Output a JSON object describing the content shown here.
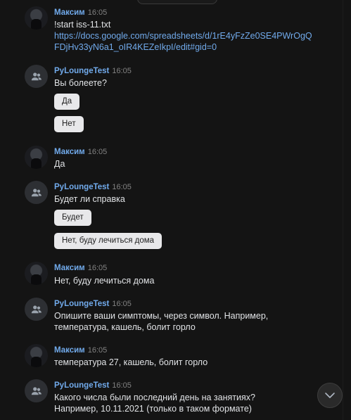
{
  "messages": [
    {
      "author": "Максим",
      "time": "16:05",
      "text": "!start iss-11.txt",
      "link_line1": "https://docs.google.com/spreadsheets/d/1rE4yFzZe0SE4PWrOgQ",
      "link_line2": "FDjHv33yN6a1_oIR4KEZeIkpI/edit#gid=0"
    },
    {
      "author": "PyLoungeTest",
      "time": "16:05",
      "text": "Вы болеете?",
      "buttons": [
        "Да",
        "Нет"
      ]
    },
    {
      "author": "Максим",
      "time": "16:05",
      "text": "Да"
    },
    {
      "author": "PyLoungeTest",
      "time": "16:05",
      "text": "Будет ли справка",
      "buttons": [
        "Будет",
        "Нет, буду лечиться дома"
      ]
    },
    {
      "author": "Максим",
      "time": "16:05",
      "text": "Нет, буду лечиться дома"
    },
    {
      "author": "PyLoungeTest",
      "time": "16:05",
      "line1": "Опишите ваши симптомы, через символ. Например,",
      "line2": "температура, кашель, болит горло"
    },
    {
      "author": "Максим",
      "time": "16:05",
      "text": "температура 27, кашель, болит горло"
    },
    {
      "author": "PyLoungeTest",
      "time": "16:05",
      "line1": "Какого числа были последний день на занятиях?",
      "line2": "Например, 10.11.2021 (только в таком формате)"
    }
  ],
  "icons": {
    "user_avatar": "user-avatar",
    "group_avatar": "community-icon",
    "scroll_down": "chevron-down-icon"
  }
}
